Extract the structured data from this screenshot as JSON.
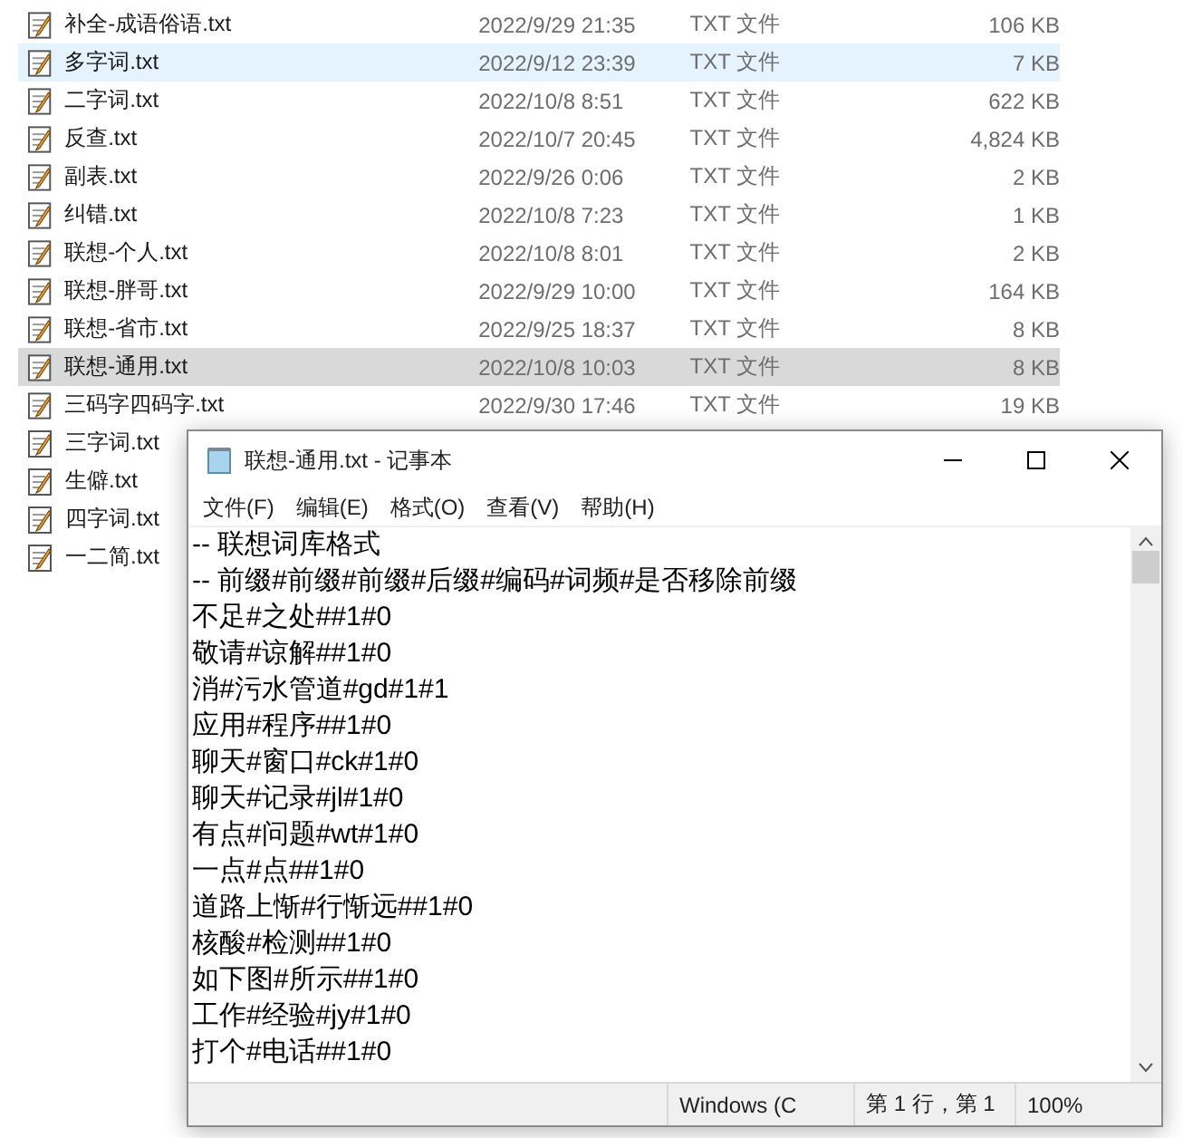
{
  "files": [
    {
      "name": "补全-成语俗语.txt",
      "date": "2022/9/29 21:35",
      "type": "TXT 文件",
      "size": "106 KB",
      "selected": false,
      "hovered": false
    },
    {
      "name": "多字词.txt",
      "date": "2022/9/12 23:39",
      "type": "TXT 文件",
      "size": "7 KB",
      "selected": false,
      "hovered": true
    },
    {
      "name": "二字词.txt",
      "date": "2022/10/8 8:51",
      "type": "TXT 文件",
      "size": "622 KB",
      "selected": false,
      "hovered": false
    },
    {
      "name": "反查.txt",
      "date": "2022/10/7 20:45",
      "type": "TXT 文件",
      "size": "4,824 KB",
      "selected": false,
      "hovered": false
    },
    {
      "name": "副表.txt",
      "date": "2022/9/26 0:06",
      "type": "TXT 文件",
      "size": "2 KB",
      "selected": false,
      "hovered": false
    },
    {
      "name": "纠错.txt",
      "date": "2022/10/8 7:23",
      "type": "TXT 文件",
      "size": "1 KB",
      "selected": false,
      "hovered": false
    },
    {
      "name": "联想-个人.txt",
      "date": "2022/10/8 8:01",
      "type": "TXT 文件",
      "size": "2 KB",
      "selected": false,
      "hovered": false
    },
    {
      "name": "联想-胖哥.txt",
      "date": "2022/9/29 10:00",
      "type": "TXT 文件",
      "size": "164 KB",
      "selected": false,
      "hovered": false
    },
    {
      "name": "联想-省市.txt",
      "date": "2022/9/25 18:37",
      "type": "TXT 文件",
      "size": "8 KB",
      "selected": false,
      "hovered": false
    },
    {
      "name": "联想-通用.txt",
      "date": "2022/10/8 10:03",
      "type": "TXT 文件",
      "size": "8 KB",
      "selected": true,
      "hovered": false
    },
    {
      "name": "三码字四码字.txt",
      "date": "2022/9/30 17:46",
      "type": "TXT 文件",
      "size": "19 KB",
      "selected": false,
      "hovered": false
    },
    {
      "name": "三字词.txt",
      "selected": false,
      "hovered": false
    },
    {
      "name": "生僻.txt",
      "selected": false,
      "hovered": false
    },
    {
      "name": "四字词.txt",
      "selected": false,
      "hovered": false
    },
    {
      "name": "一二简.txt",
      "selected": false,
      "hovered": false
    }
  ],
  "notepad": {
    "title": "联想-通用.txt - 记事本",
    "menu": [
      "文件(F)",
      "编辑(E)",
      "格式(O)",
      "查看(V)",
      "帮助(H)"
    ],
    "lines": [
      "-- 联想词库格式",
      "-- 前缀#前缀#前缀#后缀#编码#词频#是否移除前缀",
      "不足#之处##1#0",
      "敬请#谅解##1#0",
      "消#污水管道#gd#1#1",
      "应用#程序##1#0",
      "聊天#窗口#ck#1#0",
      "聊天#记录#jl#1#0",
      "有点#问题#wt#1#0",
      "一点#点##1#0",
      "道路上惭#行惭远##1#0",
      "核酸#检测##1#0",
      "如下图#所示##1#0",
      "工作#经验#jy#1#0",
      "打个#电话##1#0"
    ],
    "status_bar": [
      "Windows (C",
      "第 1 行，第 1",
      "100%"
    ]
  }
}
